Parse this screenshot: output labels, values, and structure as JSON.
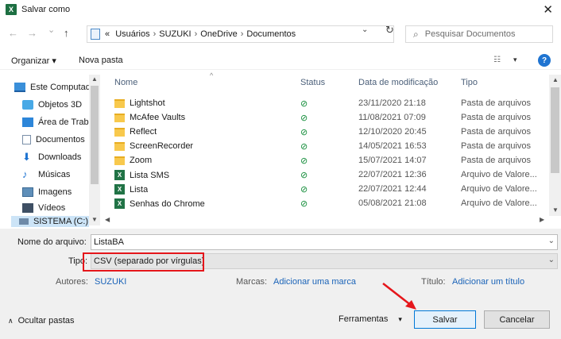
{
  "window": {
    "app_icon": "X",
    "title": "Salvar como",
    "close_glyph": "✕"
  },
  "navigation": {
    "back_glyph": "←",
    "forward_glyph": "→",
    "dropdown_glyph": "⌄",
    "up_glyph": "↑",
    "prefix_glyph": "«",
    "path": [
      "Usuários",
      "SUZUKI",
      "OneDrive",
      "Documentos"
    ],
    "separator": "›",
    "refresh_glyph": "↻",
    "search_placeholder": "Pesquisar Documentos"
  },
  "toolbar": {
    "organize_label": "Organizar ▾",
    "new_folder_label": "Nova pasta",
    "view_glyph": "☷",
    "view_dropdown_glyph": "▾",
    "help_label": "?"
  },
  "nav_pane": {
    "items": [
      {
        "label": "Este Computador",
        "icon": "computer-icon"
      },
      {
        "label": "Objetos 3D",
        "icon": "cube-icon"
      },
      {
        "label": "Área de Trabalho",
        "icon": "desktop-icon"
      },
      {
        "label": "Documentos",
        "icon": "document-icon"
      },
      {
        "label": "Downloads",
        "icon": "download-icon"
      },
      {
        "label": "Músicas",
        "icon": "music-icon"
      },
      {
        "label": "Imagens",
        "icon": "image-icon"
      },
      {
        "label": "Vídeos",
        "icon": "video-icon"
      }
    ],
    "last_item": "SISTEMA (C:)"
  },
  "columns": {
    "name": "Nome",
    "status": "Status",
    "date": "Data de modificação",
    "type": "Tipo"
  },
  "files": [
    {
      "name": "Lightshot",
      "kind": "folder",
      "status": "⊘",
      "date": "23/11/2020 21:18",
      "type": "Pasta de arquivos"
    },
    {
      "name": "McAfee Vaults",
      "kind": "folder",
      "status": "⊘",
      "date": "11/08/2021 07:09",
      "type": "Pasta de arquivos"
    },
    {
      "name": "Reflect",
      "kind": "folder",
      "status": "⊘",
      "date": "12/10/2020 20:45",
      "type": "Pasta de arquivos"
    },
    {
      "name": "ScreenRecorder",
      "kind": "folder",
      "status": "⊘",
      "date": "14/05/2021 16:53",
      "type": "Pasta de arquivos"
    },
    {
      "name": "Zoom",
      "kind": "folder",
      "status": "⊘",
      "date": "15/07/2021 14:07",
      "type": "Pasta de arquivos"
    },
    {
      "name": "Lista SMS",
      "kind": "excel",
      "status": "⊘",
      "date": "22/07/2021 12:36",
      "type": "Arquivo de Valore..."
    },
    {
      "name": "Lista",
      "kind": "excel",
      "status": "⊘",
      "date": "22/07/2021 12:44",
      "type": "Arquivo de Valore..."
    },
    {
      "name": "Senhas do Chrome",
      "kind": "excel",
      "status": "⊘",
      "date": "05/08/2021 21:08",
      "type": "Arquivo de Valore..."
    }
  ],
  "form": {
    "filename_label": "Nome do arquivo:",
    "filename_value": "ListaBA",
    "type_label": "Tipo:",
    "type_value": "CSV (separado por vírgulas)",
    "authors_label": "Autores:",
    "authors_value": "SUZUKI",
    "tags_label": "Marcas:",
    "tags_value": "Adicionar uma marca",
    "title_label": "Título:",
    "title_value": "Adicionar um título"
  },
  "footer": {
    "hide_folders_label": "Ocultar pastas",
    "tools_label": "Ferramentas",
    "save_label": "Salvar",
    "cancel_label": "Cancelar"
  },
  "colors": {
    "highlight_red": "#e5161b",
    "link_blue": "#1a63b8",
    "status_green": "#0e8a35",
    "selection": "#cce4f7"
  }
}
